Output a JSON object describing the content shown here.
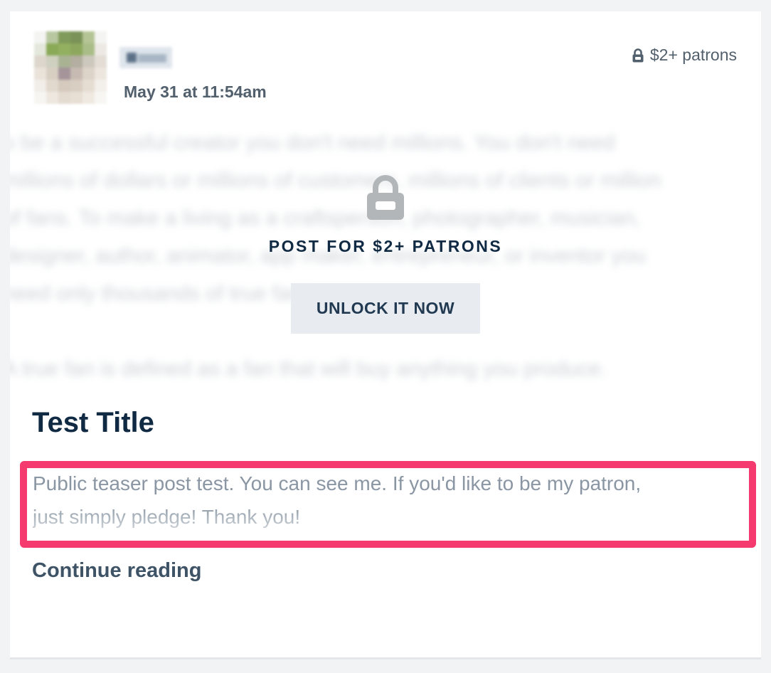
{
  "post": {
    "date": "May 31 at 11:54am",
    "tier_badge": "$2+ patrons",
    "locked_label": "POST FOR $2+ PATRONS",
    "unlock_button": "UNLOCK IT NOW",
    "title": "Test Title",
    "teaser_line1": "Public teaser post test. You can see me. If you'd like to be my patron,",
    "teaser_line2": "just simply pledge! Thank you!",
    "continue_link": "Continue reading"
  },
  "icons": {
    "tier_badge_icon": "lock-icon",
    "locked_overlay_icon": "lock-icon"
  },
  "colors": {
    "title": "#102a43",
    "meta_text": "#52606d",
    "unlock_button_bg": "#e8ecf1",
    "highlight_border": "#f43a6e",
    "teaser_text": "#8a96a3"
  }
}
